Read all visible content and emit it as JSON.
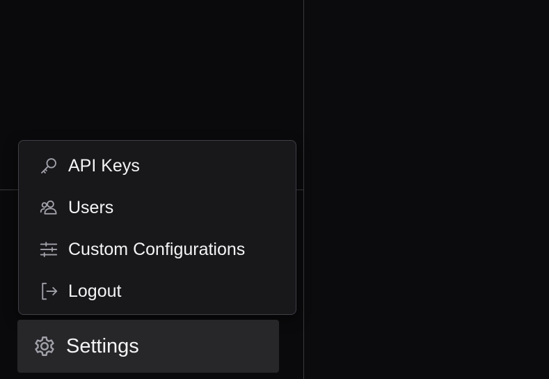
{
  "menu": {
    "items": [
      {
        "label": "API Keys",
        "icon": "key-icon"
      },
      {
        "label": "Users",
        "icon": "users-icon"
      },
      {
        "label": "Custom Configurations",
        "icon": "sliders-icon"
      },
      {
        "label": "Logout",
        "icon": "logout-icon"
      }
    ]
  },
  "settings": {
    "label": "Settings",
    "icon": "gear-icon"
  },
  "colors": {
    "background": "#0a0a0c",
    "menu_background": "#18181b",
    "menu_border": "#3f3f46",
    "settings_background": "#27272a",
    "text": "#f4f4f5",
    "icon": "#a1a1aa",
    "divider": "#3a3a3e"
  }
}
